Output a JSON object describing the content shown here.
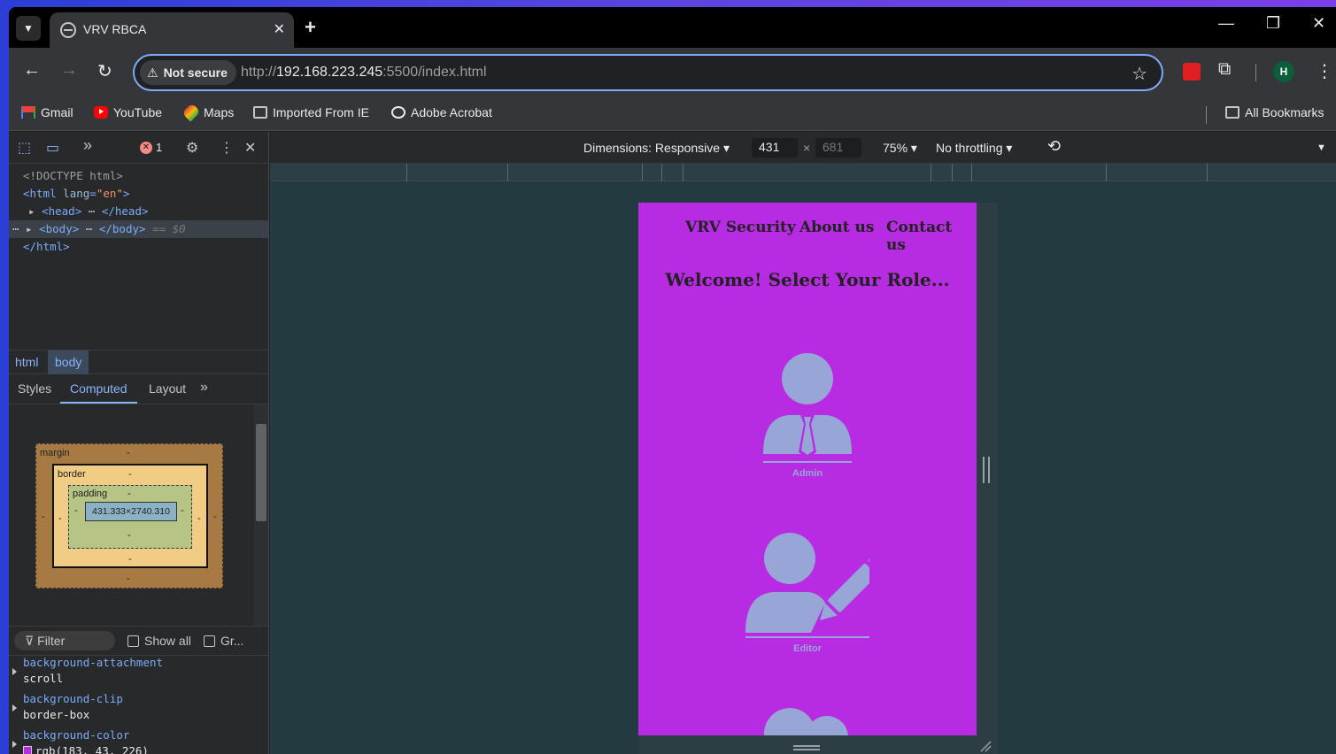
{
  "browser": {
    "tab_title": "VRV RBCA",
    "not_secure_label": "Not secure",
    "url_prefix": "http://",
    "url_host": "192.168.223.245",
    "url_rest": ":5500/index.html",
    "profile_initial": "H"
  },
  "bookmarks": {
    "items": [
      {
        "label": "Gmail",
        "icon": "gmail-icon"
      },
      {
        "label": "YouTube",
        "icon": "youtube-icon"
      },
      {
        "label": "Maps",
        "icon": "maps-icon"
      },
      {
        "label": "Imported From IE",
        "icon": "folder-icon"
      },
      {
        "label": "Adobe Acrobat",
        "icon": "globe-icon"
      }
    ],
    "all_bookmarks": "All Bookmarks"
  },
  "devtools": {
    "error_count": "1",
    "dom": {
      "doctype": "<!DOCTYPE html>",
      "html_open": "<html",
      "lang_attr": "lang",
      "lang_val": "\"en\"",
      "head": "<head>",
      "head_close": "</head>",
      "body": "<body>",
      "body_close": "</body>",
      "dollar": "== $0",
      "html_close": "</html>"
    },
    "breadcrumbs": [
      "html",
      "body"
    ],
    "subtabs": [
      "Styles",
      "Computed",
      "Layout"
    ],
    "box_model": {
      "margin_label": "margin",
      "border_label": "border",
      "padding_label": "padding",
      "content": "431.333×2740.310",
      "dash": "-"
    },
    "filter_placeholder": "Filter",
    "show_all": "Show all",
    "group": "Gr...",
    "computed_props": [
      {
        "name": "background-attachment",
        "value": "scroll"
      },
      {
        "name": "background-clip",
        "value": "border-box"
      },
      {
        "name": "background-color",
        "value": "rgb(183, 43, 226)"
      }
    ]
  },
  "device_toolbar": {
    "dimensions": "Dimensions: Responsive",
    "width": "431",
    "times": "×",
    "height": "681",
    "zoom": "75%",
    "throttling": "No throttling"
  },
  "page": {
    "nav": [
      "VRV Security",
      "About us",
      "Contact us"
    ],
    "heading": "Welcome! Select Your Role...",
    "roles": [
      "Admin",
      "Editor"
    ],
    "background": "#b72be2",
    "icon_color": "#97a6d6"
  }
}
